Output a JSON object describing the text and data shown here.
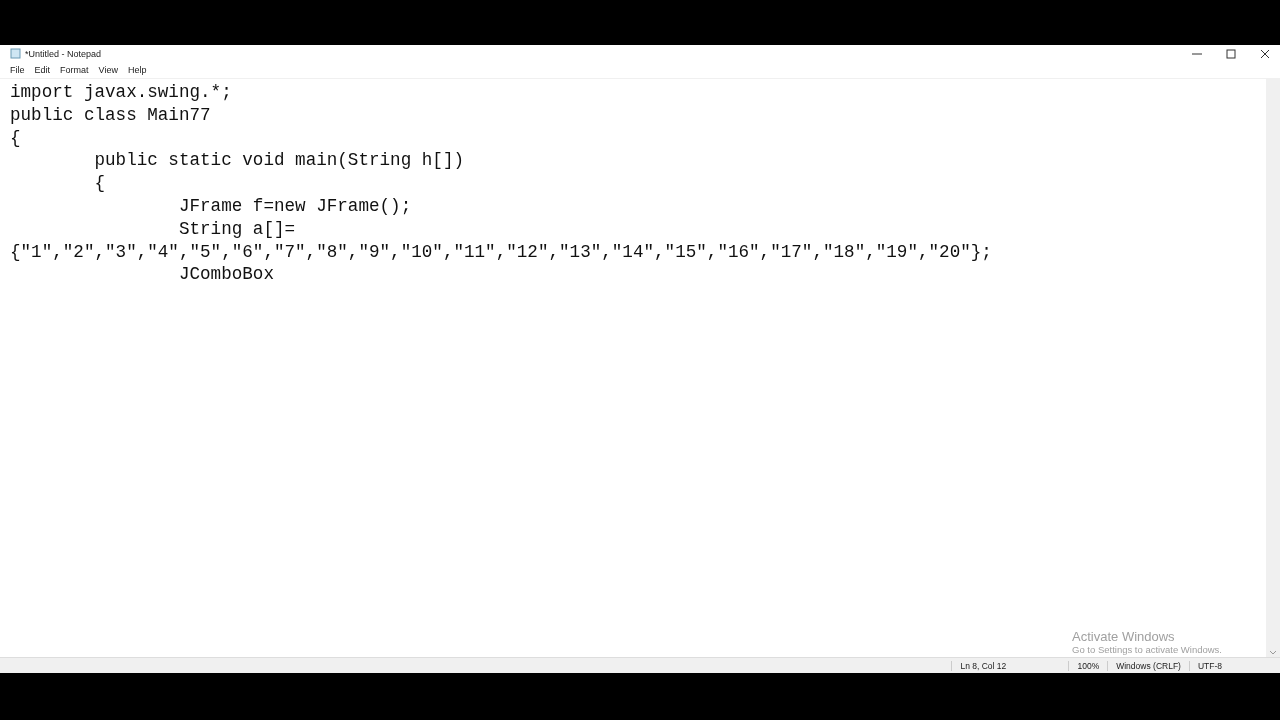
{
  "window": {
    "title": "*Untitled - Notepad"
  },
  "menu": [
    "File",
    "Edit",
    "Format",
    "View",
    "Help"
  ],
  "editor": {
    "lines": [
      "import javax.swing.*;",
      "public class Main77",
      "{",
      "\tpublic static void main(String h[])",
      "\t{",
      "\t\tJFrame f=new JFrame();",
      "\t\tString a[]=",
      "{\"1\",\"2\",\"3\",\"4\",\"5\",\"6\",\"7\",\"8\",\"9\",\"10\",\"11\",\"12\",\"13\",\"14\",\"15\",\"16\",\"17\",\"18\",\"19\",\"20\"};",
      "\t\tJComboBox"
    ]
  },
  "activation_notice": {
    "title": "Activate Windows",
    "message": "Go to Settings to activate Windows."
  },
  "status_bar": [
    "Ln 8, Col 12",
    "100%",
    "Windows (CRLF)",
    "UTF-8"
  ]
}
